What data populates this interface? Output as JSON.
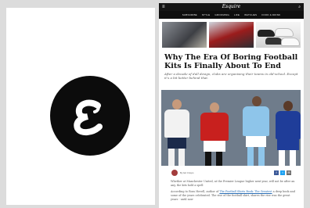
{
  "left_card": {
    "logo_glyph": "ε",
    "logo_colors": {
      "circle": "#0c0c0c",
      "glyph": "#ffffff"
    }
  },
  "site": {
    "menu_icon": "≡",
    "brand": "Esquire",
    "search_icon": "⌕",
    "nav": [
      "SUBSCRIBE",
      "STYLE",
      "GROOMING",
      "LIFE",
      "WATCHES",
      "FOOD & DRINK"
    ]
  },
  "article": {
    "headline": "Why The Era Of Boring Football Kits Is Finally About To End",
    "dek": "After a decade of dull design, clubs are organising their teams in old-school. Except it’s a bit better behind that.",
    "author": "By Ed Cripps",
    "share": {
      "facebook": "f",
      "twitter": "t",
      "email": "✉"
    },
    "paragraph1": "Whether at Manchester United, at the Premier League higher next year, will not be after an any, the kits hold a spell",
    "paragraph2_prefix": "According to Ross Hovell, author of ",
    "paragraph2_link": "The Football Shirts Book: The Greatest",
    "paragraph2_suffix": " a deep book and some of the years celebrated. The rise of the football shirt, shares the rise was the great years - until now"
  },
  "colors": {
    "topbar": "#141414",
    "navbar": "#0e0e0e",
    "facebook": "#3b5998",
    "twitter": "#1da1f2",
    "email": "#6d6d6d"
  }
}
